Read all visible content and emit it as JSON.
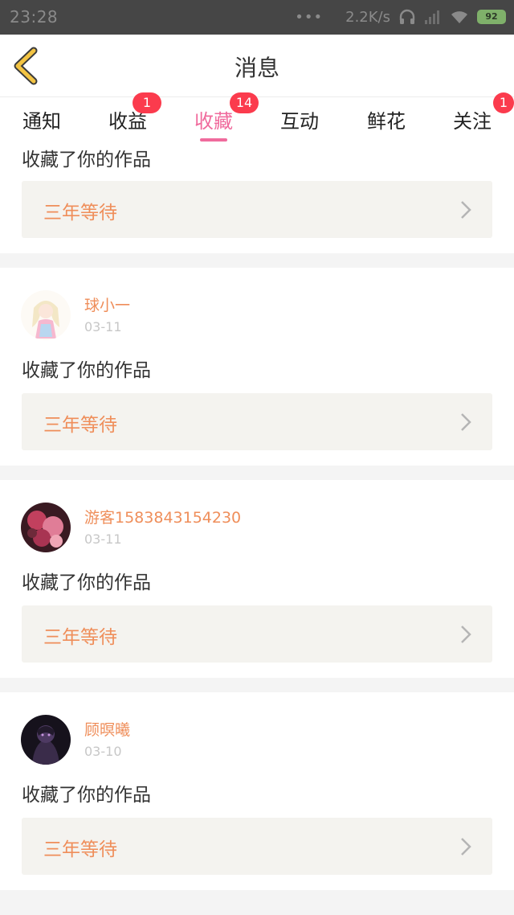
{
  "status_bar": {
    "time": "23:28",
    "dots": "•••",
    "speed": "2.2K/s",
    "battery": "92"
  },
  "header": {
    "title": "消息",
    "back_icon": "chevron-left-icon",
    "back_color": "#f3c443"
  },
  "tabs": [
    {
      "label": "通知",
      "badge": "",
      "active": false
    },
    {
      "label": "收益",
      "badge": "1",
      "active": false
    },
    {
      "label": "收藏",
      "badge": "14",
      "active": true
    },
    {
      "label": "互动",
      "badge": "",
      "active": false
    },
    {
      "label": "鲜花",
      "badge": "",
      "active": false
    },
    {
      "label": "关注",
      "badge": "1",
      "active": false
    }
  ],
  "colors": {
    "accent_pink": "#f06b9d",
    "badge_red": "#fb3b4d",
    "name_orange": "#ef8e5a"
  },
  "notifications": [
    {
      "user": "",
      "date": "",
      "action": "收藏了你的作品",
      "work": "三年等待"
    },
    {
      "user": "球小一",
      "date": "03-11",
      "action": "收藏了你的作品",
      "work": "三年等待"
    },
    {
      "user": "游客1583843154230",
      "date": "03-11",
      "action": "收藏了你的作品",
      "work": "三年等待"
    },
    {
      "user": "顾暝曦",
      "date": "03-10",
      "action": "收藏了你的作品",
      "work": "三年等待"
    }
  ]
}
